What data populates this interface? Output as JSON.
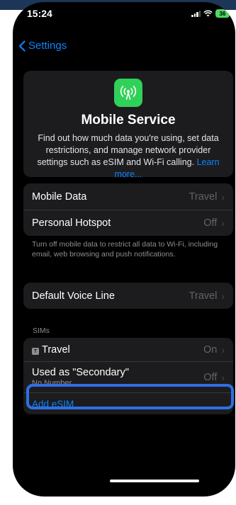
{
  "status_bar": {
    "time": "15:24",
    "battery_level": "36"
  },
  "nav": {
    "back_label": "Settings"
  },
  "hero": {
    "icon": "antenna-icon",
    "title": "Mobile Service",
    "description": "Find out how much data you're using, set data restrictions, and manage network provider settings such as eSIM and Wi-Fi calling.",
    "link_text": "Learn more..."
  },
  "data_group": {
    "rows": [
      {
        "label": "Mobile Data",
        "value": "Travel"
      },
      {
        "label": "Personal Hotspot",
        "value": "Off"
      }
    ],
    "footnote": "Turn off mobile data to restrict all data to Wi-Fi, including email, web browsing and push notifications."
  },
  "voice_group": {
    "label": "Default Voice Line",
    "value": "Travel"
  },
  "sims": {
    "header": "SIMs",
    "badge": "T",
    "travel_label": "Travel",
    "travel_value": "On",
    "secondary_label": "Used as \"Secondary\"",
    "secondary_sublabel": "No Number",
    "secondary_value": "Off",
    "add_esim": "Add eSIM"
  },
  "colors": {
    "accent": "#0a84ff",
    "icon_green": "#30d158",
    "highlight": "#2f6fe4"
  }
}
